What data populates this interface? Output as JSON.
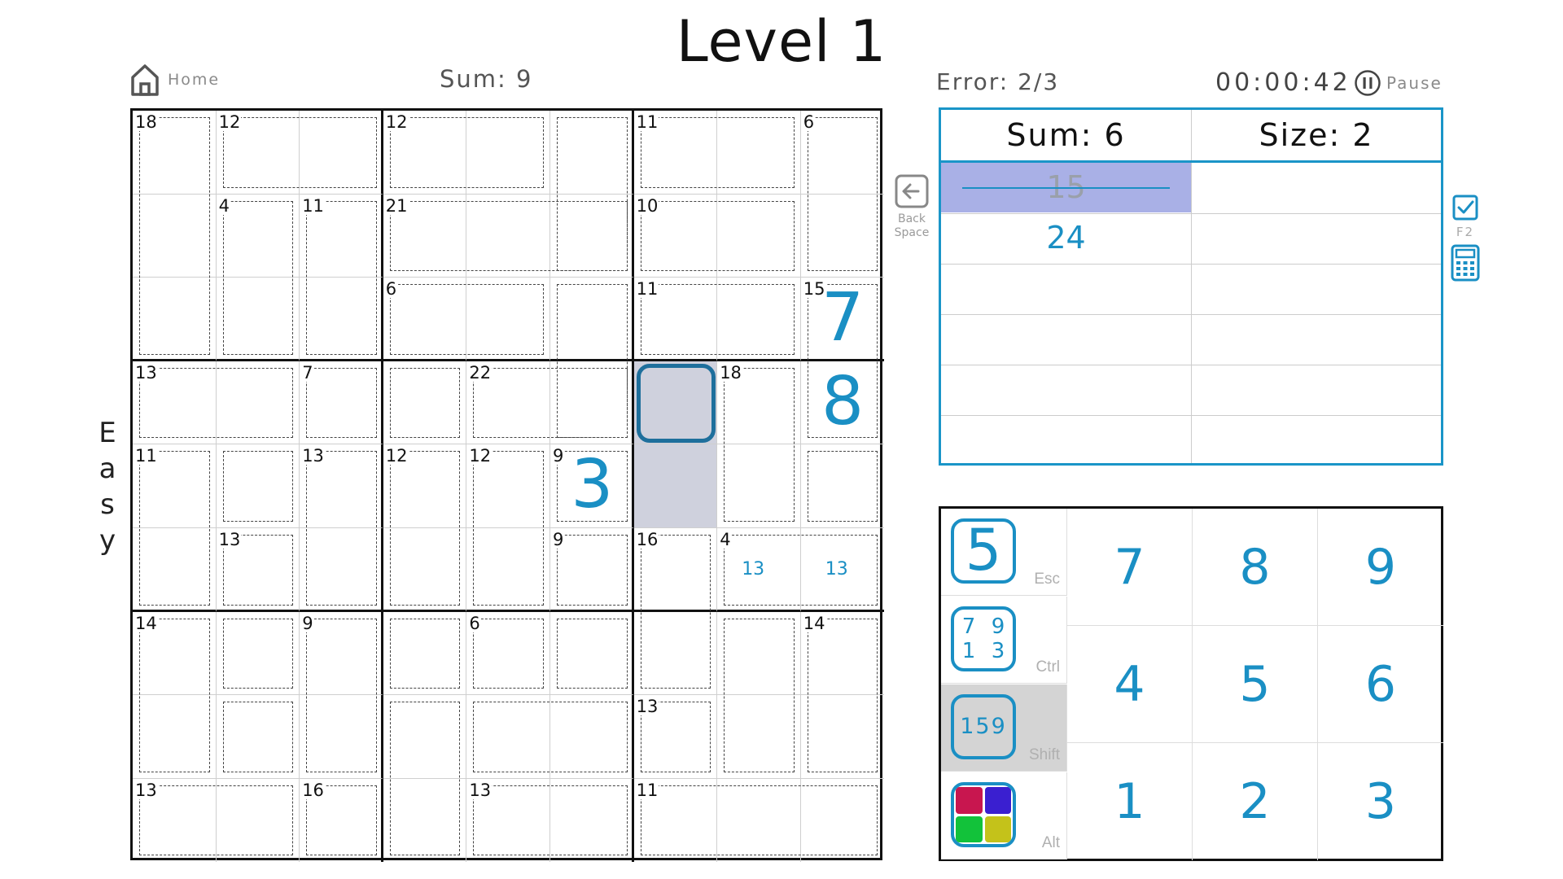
{
  "title": "Level 1",
  "difficulty": "Easy",
  "header": {
    "home_label": "Home",
    "sum_label": "Sum: 9",
    "error_label": "Error: 2/3",
    "timer": "00:00:42",
    "pause_label": "Pause"
  },
  "board": {
    "cage_sums": [
      {
        "label": "18",
        "r": 0,
        "c": 0
      },
      {
        "label": "12",
        "r": 0,
        "c": 1
      },
      {
        "label": "12",
        "r": 0,
        "c": 3
      },
      {
        "label": "11",
        "r": 0,
        "c": 6
      },
      {
        "label": "6",
        "r": 0,
        "c": 8
      },
      {
        "label": "4",
        "r": 1,
        "c": 1
      },
      {
        "label": "11",
        "r": 1,
        "c": 2
      },
      {
        "label": "21",
        "r": 1,
        "c": 3
      },
      {
        "label": "10",
        "r": 1,
        "c": 6
      },
      {
        "label": "6",
        "r": 2,
        "c": 3
      },
      {
        "label": "11",
        "r": 2,
        "c": 6
      },
      {
        "label": "15",
        "r": 2,
        "c": 8
      },
      {
        "label": "13",
        "r": 3,
        "c": 0
      },
      {
        "label": "7",
        "r": 3,
        "c": 2
      },
      {
        "label": "22",
        "r": 3,
        "c": 4
      },
      {
        "label": "18",
        "r": 3,
        "c": 7
      },
      {
        "label": "11",
        "r": 4,
        "c": 0
      },
      {
        "label": "13",
        "r": 4,
        "c": 2
      },
      {
        "label": "12",
        "r": 4,
        "c": 3
      },
      {
        "label": "12",
        "r": 4,
        "c": 4
      },
      {
        "label": "9",
        "r": 4,
        "c": 5
      },
      {
        "label": "13",
        "r": 5,
        "c": 1
      },
      {
        "label": "9",
        "r": 5,
        "c": 5
      },
      {
        "label": "16",
        "r": 5,
        "c": 6
      },
      {
        "label": "4",
        "r": 5,
        "c": 7
      },
      {
        "label": "14",
        "r": 6,
        "c": 0
      },
      {
        "label": "9",
        "r": 6,
        "c": 2
      },
      {
        "label": "6",
        "r": 6,
        "c": 4
      },
      {
        "label": "14",
        "r": 6,
        "c": 8
      },
      {
        "label": "13",
        "r": 7,
        "c": 6
      },
      {
        "label": "13",
        "r": 8,
        "c": 0
      },
      {
        "label": "16",
        "r": 8,
        "c": 2
      },
      {
        "label": "13",
        "r": 8,
        "c": 4
      },
      {
        "label": "11",
        "r": 8,
        "c": 6
      }
    ],
    "values": [
      {
        "r": 2,
        "c": 8,
        "value": "7"
      },
      {
        "r": 3,
        "c": 8,
        "value": "8"
      },
      {
        "r": 4,
        "c": 5,
        "value": "3"
      }
    ],
    "notes": [
      {
        "r": 5,
        "c": 7,
        "text": "13"
      },
      {
        "r": 5,
        "c": 8,
        "text": "13"
      }
    ],
    "selected_cell": {
      "r": 3,
      "c": 6
    }
  },
  "combinations": {
    "sum_label": "Sum: 6",
    "size_label": "Size: 2",
    "entries": [
      {
        "text": "15",
        "crossed": true
      },
      {
        "text": "24",
        "crossed": false
      }
    ]
  },
  "side_buttons": {
    "backspace_line1": "Back",
    "backspace_line2": "Space",
    "f2_label": "F2"
  },
  "keypad": {
    "modes": [
      {
        "key": "Esc",
        "display": "5",
        "active": false
      },
      {
        "key": "Ctrl",
        "display": [
          "7",
          "9",
          "1",
          "3"
        ],
        "active": false
      },
      {
        "key": "Shift",
        "display": "159",
        "active": true
      },
      {
        "key": "Alt",
        "display": "",
        "active": false
      }
    ],
    "numbers": [
      "7",
      "8",
      "9",
      "4",
      "5",
      "6",
      "1",
      "2",
      "3"
    ],
    "colors": {
      "accent": "#1a8fc4",
      "color_red": "#c8164f",
      "color_blue": "#3a1fd0",
      "color_green": "#12c23a",
      "color_yellow": "#c4c21a"
    }
  }
}
